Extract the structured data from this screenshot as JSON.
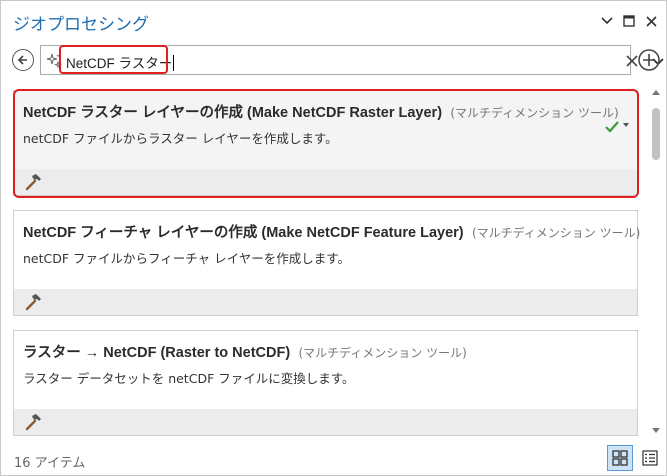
{
  "window": {
    "title": "ジオプロセシング"
  },
  "search": {
    "value": "NetCDF ラスター"
  },
  "results": [
    {
      "name": "NetCDF ラスター レイヤーの作成 (Make NetCDF Raster Layer)",
      "type": "(マルチディメンション ツール)",
      "description": "netCDF ファイルからラスター レイヤーを作成します。",
      "selected": true
    },
    {
      "name": "NetCDF フィーチャ レイヤーの作成 (Make NetCDF Feature Layer)",
      "type": "(マルチディメンション ツール)",
      "description": "netCDF ファイルからフィーチャ レイヤーを作成します。",
      "selected": false
    },
    {
      "name": "ラスター → NetCDF (Raster to NetCDF)",
      "type": "(マルチディメンション ツール)",
      "description": "ラスター データセットを netCDF ファイルに変換します。",
      "selected": false
    }
  ],
  "footer": {
    "count": "16 アイテム"
  },
  "colors": {
    "accent": "#1f6fb5",
    "highlight": "#e02020",
    "check": "#3a9a3a"
  }
}
